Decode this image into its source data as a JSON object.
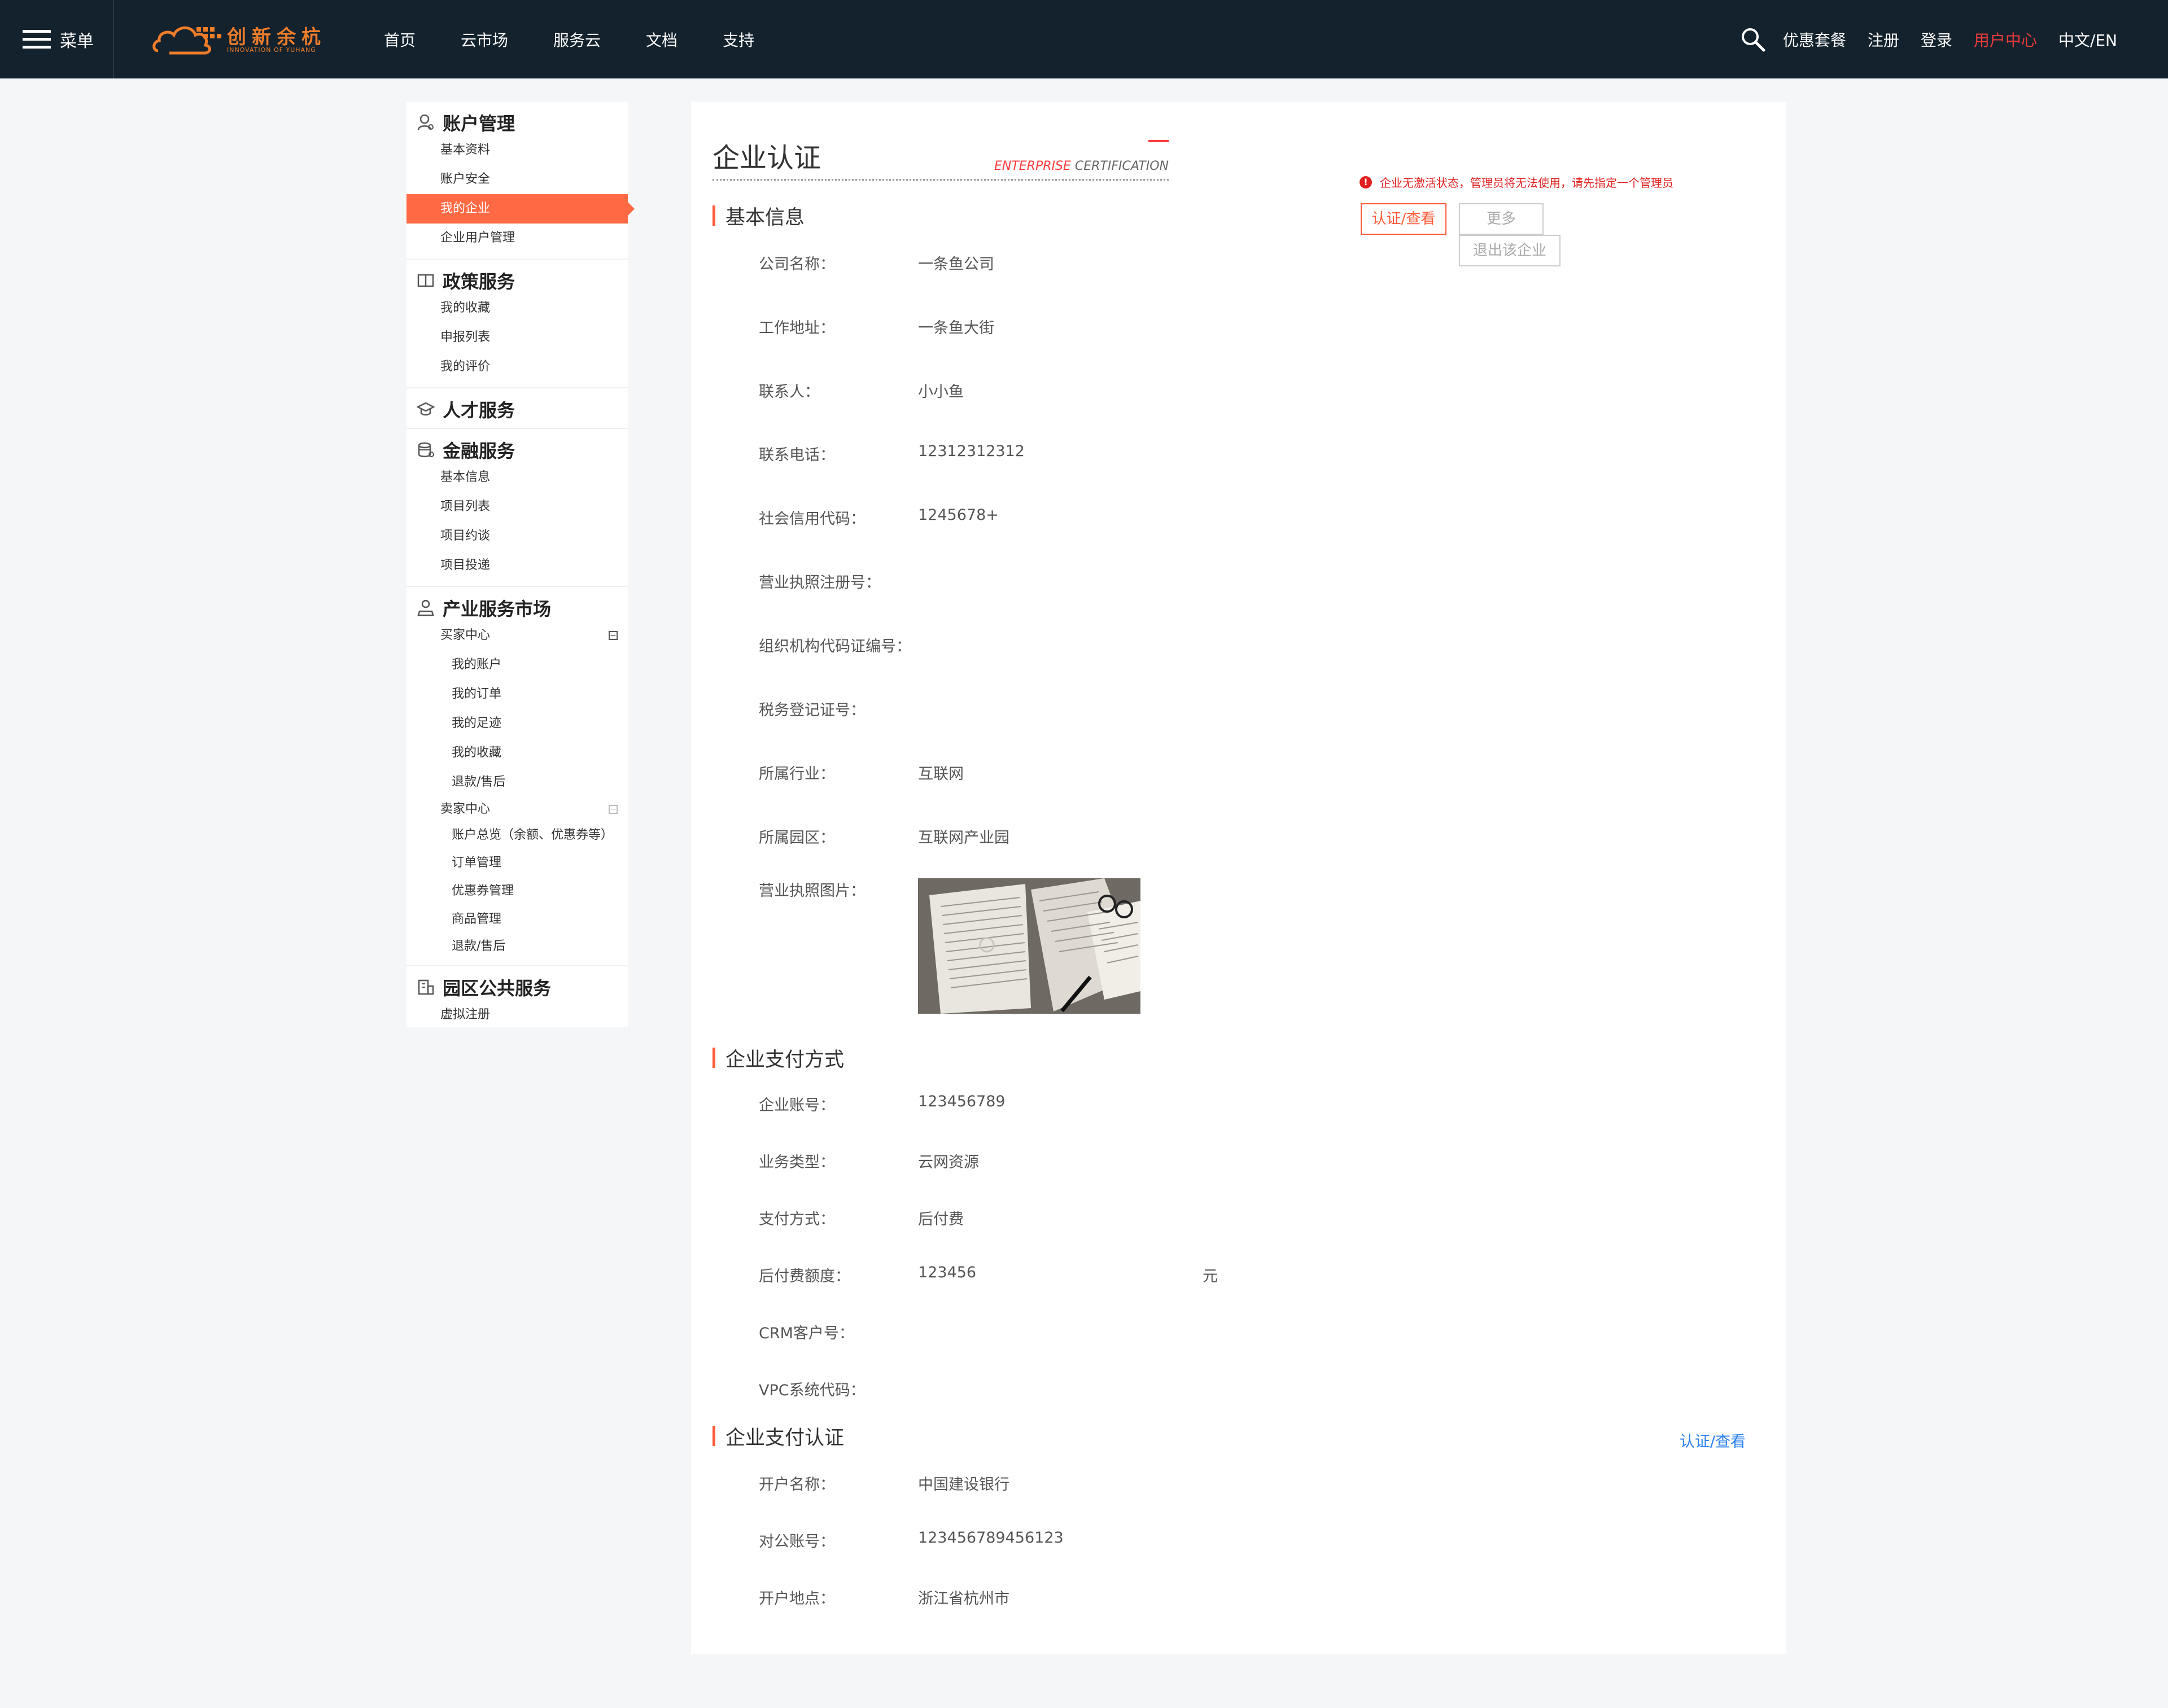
{
  "topbar": {
    "menu_label": "菜单",
    "logo_cn": "创新余杭",
    "logo_en": "INNOVATION OF YUHANG",
    "nav": [
      "首页",
      "云市场",
      "服务云",
      "文档",
      "支持"
    ],
    "right_links": [
      "优惠套餐",
      "注册",
      "登录",
      "用户中心",
      "中文/EN"
    ],
    "active_right": "用户中心"
  },
  "sidebar": {
    "account": {
      "title": "账户管理",
      "items": [
        "基本资料",
        "账户安全",
        "我的企业",
        "企业用户管理"
      ]
    },
    "policy": {
      "title": "政策服务",
      "items": [
        "我的收藏",
        "申报列表",
        "我的评价"
      ]
    },
    "talent": {
      "title": "人才服务"
    },
    "finance": {
      "title": "金融服务",
      "items": [
        "基本信息",
        "项目列表",
        "项目约谈",
        "项目投递"
      ]
    },
    "industry": {
      "title": "产业服务市场",
      "buyer": {
        "label": "买家中心",
        "items": [
          "我的账户",
          "我的订单",
          "我的足迹",
          "我的收藏",
          "退款/售后"
        ]
      },
      "seller": {
        "label": "卖家中心",
        "items": [
          "账户总览（余额、优惠券等）",
          "订单管理",
          "优惠券管理",
          "商品管理",
          "退款/售后"
        ]
      }
    },
    "park": {
      "title": "园区公共服务",
      "items": [
        "虚拟注册"
      ]
    }
  },
  "main": {
    "title": "企业认证",
    "title_en_prefix": "ENTERPRISE",
    "title_en_suffix": " CERTIFICATION",
    "warning": "企业无激活状态，管理员将无法使用，请先指定一个管理员",
    "btn_cert": "认证/查看",
    "btn_more": "更多",
    "btn_exit": "退出该企业",
    "basic": {
      "heading": "基本信息",
      "rows": [
        {
          "label": "公司名称：",
          "value": "一条鱼公司"
        },
        {
          "label": "工作地址：",
          "value": "一条鱼大街"
        },
        {
          "label": "联系人：",
          "value": "小小鱼"
        },
        {
          "label": "联系电话：",
          "value": "12312312312"
        },
        {
          "label": "社会信用代码：",
          "value": "1245678+"
        },
        {
          "label": "营业执照注册号：",
          "value": ""
        },
        {
          "label": "组织机构代码证编号：",
          "value": ""
        },
        {
          "label": "税务登记证号：",
          "value": ""
        },
        {
          "label": "所属行业：",
          "value": "互联网"
        },
        {
          "label": "所属园区：",
          "value": "互联网产业园"
        },
        {
          "label": "营业执照图片：",
          "value": ""
        }
      ]
    },
    "payment": {
      "heading": "企业支付方式",
      "rows": [
        {
          "label": "企业账号：",
          "value": "123456789"
        },
        {
          "label": "业务类型：",
          "value": "云网资源"
        },
        {
          "label": "支付方式：",
          "value": "后付费"
        },
        {
          "label": "后付费额度：",
          "value": "123456"
        },
        {
          "label": "CRM客户号：",
          "value": ""
        },
        {
          "label": "VPC系统代码：",
          "value": ""
        }
      ],
      "unit": "元"
    },
    "pay_cert": {
      "heading": "企业支付认证",
      "link": "认证/查看",
      "rows": [
        {
          "label": "开户名称：",
          "value": "中国建设银行"
        },
        {
          "label": "对公账号：",
          "value": "123456789456123"
        },
        {
          "label": "开户地点：",
          "value": "浙江省杭州市"
        }
      ]
    }
  },
  "colors": {
    "topbar": "#13222d",
    "accent": "#ff6a45",
    "warn": "#e02020",
    "link": "#2a7ff0",
    "active_nav": "#f03b3b"
  }
}
